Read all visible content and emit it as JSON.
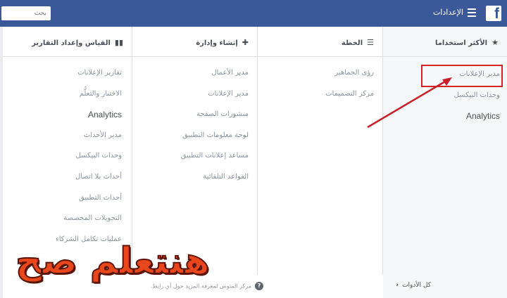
{
  "topbar": {
    "title": "الإعدادات",
    "logo_letter": "f",
    "search_placeholder": "بحث"
  },
  "columns": {
    "favorites": {
      "header": "الأكثر استخداما",
      "icon": "star-icon",
      "items": [
        "مدير الإعلانات",
        "وحدات البيكسل",
        "Analytics"
      ]
    },
    "plan": {
      "header": "الخطة",
      "icon": "list-icon",
      "items": [
        "رؤى الجماهير",
        "مركز التصميمات"
      ]
    },
    "create": {
      "header": "إنشاء وإدارة",
      "icon": "plus-icon",
      "items": [
        "مدير الأعمال",
        "مدير الإعلانات",
        "منشورات الصفحة",
        "لوحة معلومات التطبيق",
        "مساعد إعلانات التطبيق",
        "القواعد التلقائية"
      ]
    },
    "measure": {
      "header": "القياس وإعداد التقارير",
      "icon": "bar-chart-icon",
      "items": [
        "تقارير الإعلانات",
        "الاختبار والتعلُّم",
        "Analytics",
        "مدير الأحداث",
        "وحدات البيكسل",
        "أحداث بلا اتصال",
        "أحداث التطبيق",
        "التحويلات المخصصة",
        "عمليات تكامل الشركاء"
      ]
    }
  },
  "footer": {
    "help_text": "مركز المتوس لمعرفة المزيد حول أي رابط.",
    "all_tools": "كل الأدوات"
  },
  "overlay": {
    "text": "هنتعلم صح"
  },
  "colors": {
    "brand": "#3b5998",
    "highlight": "#d42329",
    "overlay": "#e8461d"
  }
}
